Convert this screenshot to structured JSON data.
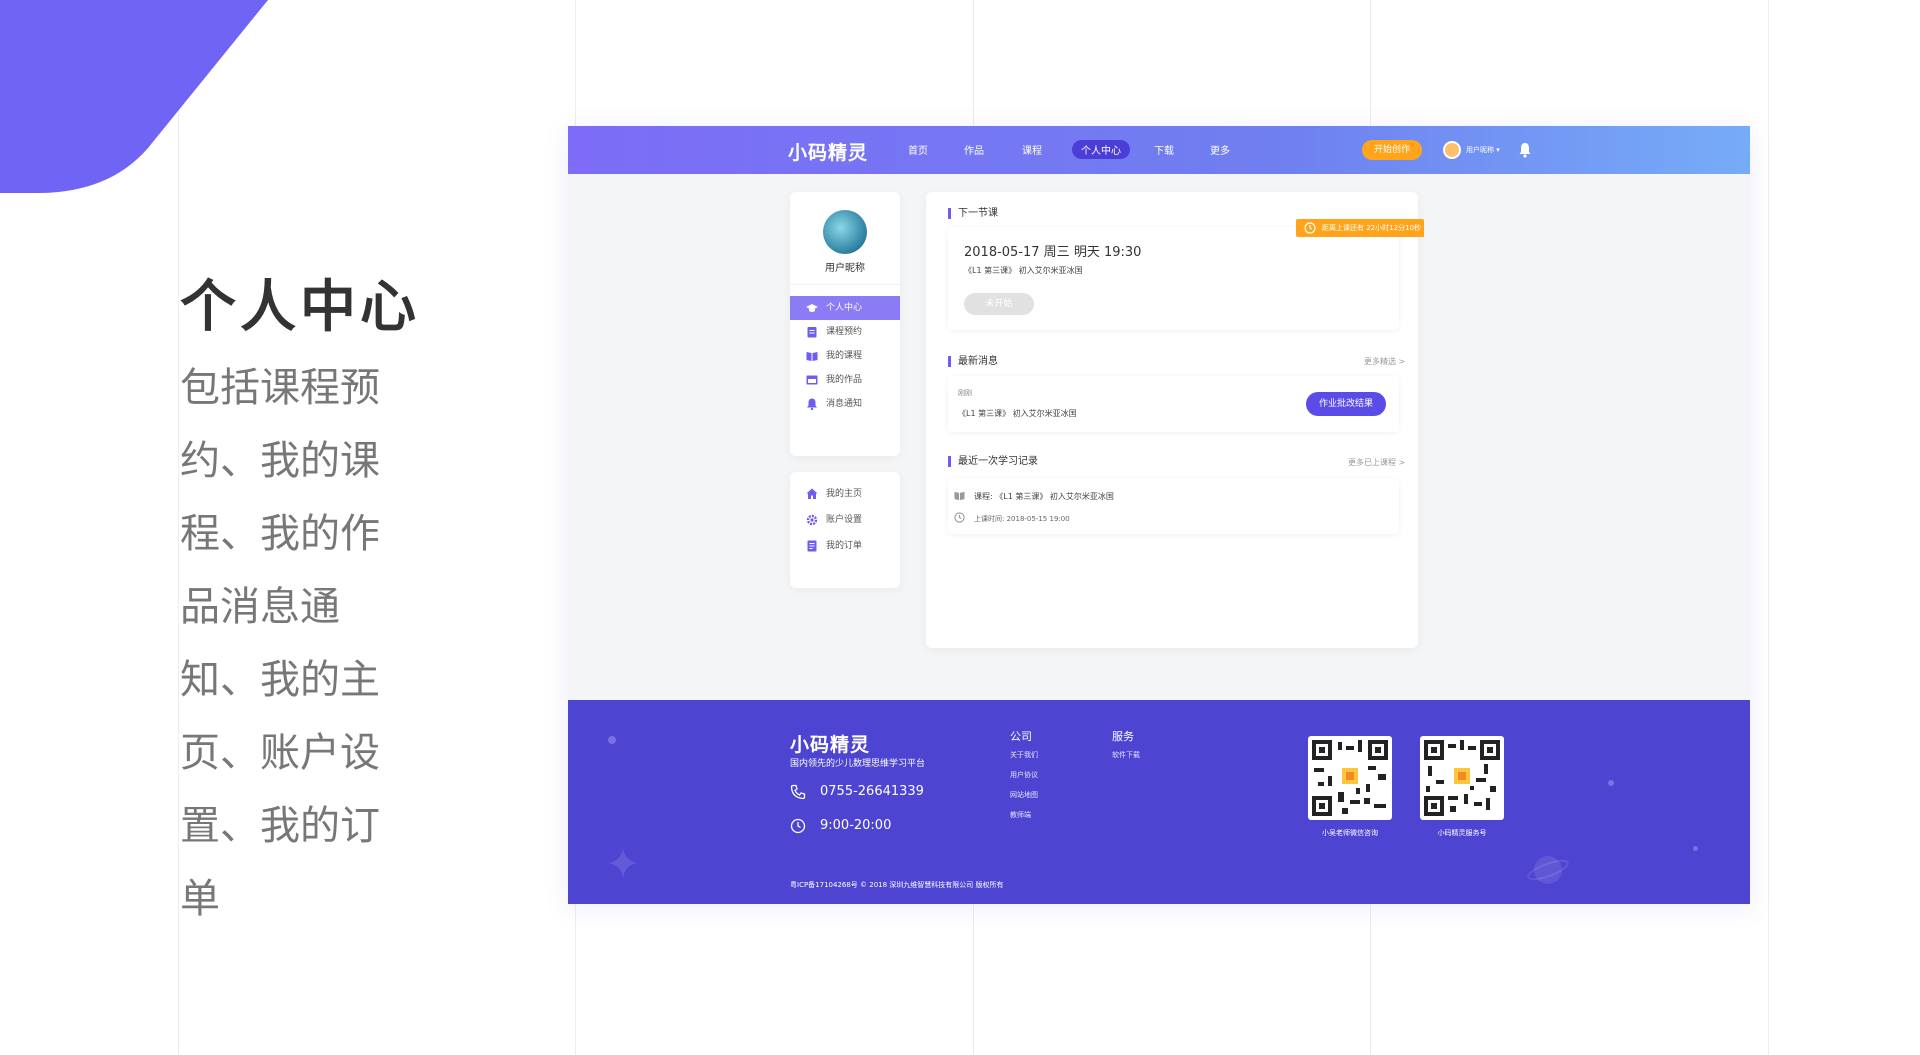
{
  "hero": {
    "title": "个人中心",
    "description": "包括课程预约、我的课程、我的作品消息通知、我的主页、账户设置、我的订单"
  },
  "topbar": {
    "logo": "小码精灵",
    "nav": [
      "首页",
      "作品",
      "课程",
      "个人中心",
      "下载",
      "更多"
    ],
    "active_nav": "个人中心",
    "start_button": "开始创作",
    "username": "用户昵称 ▾"
  },
  "sidebar": {
    "nickname": "用户昵称",
    "menu1": [
      {
        "label": "个人中心",
        "icon": "graduation-cap-icon"
      },
      {
        "label": "课程预约",
        "icon": "clipboard-icon"
      },
      {
        "label": "我的课程",
        "icon": "book-icon"
      },
      {
        "label": "我的作品",
        "icon": "gallery-icon"
      },
      {
        "label": "消息通知",
        "icon": "bell-icon"
      }
    ],
    "menu2": [
      {
        "label": "我的主页",
        "icon": "home-icon"
      },
      {
        "label": "账户设置",
        "icon": "gear-icon"
      },
      {
        "label": "我的订单",
        "icon": "order-icon"
      }
    ]
  },
  "next_lesson": {
    "section_title": "下一节课",
    "countdown": "距离上课还有 22小时12分10秒",
    "time": "2018-05-17  周三  明天  19:30",
    "name": "《L1 第三课》 初入艾尔米亚冰国",
    "status_button": "未开始"
  },
  "latest_message": {
    "section_title": "最新消息",
    "more": "更多精选 >",
    "time": "刚刚",
    "text": "《L1 第三课》 初入艾尔米亚冰国",
    "action_button": "作业批改结果"
  },
  "last_record": {
    "section_title": "最近一次学习记录",
    "more": "更多已上课程 >",
    "course_line": "课程:  《L1 第三课》 初入艾尔米亚冰国",
    "time_line": "上课时间:  2018-05-15 19:00"
  },
  "footer": {
    "logo": "小码精灵",
    "slogan": "国内领先的少儿数理思维学习平台",
    "phone": "0755-26641339",
    "hours": "9:00-20:00",
    "company_title": "公司",
    "company_links": [
      "关于我们",
      "用户协议",
      "网站地图",
      "教师端"
    ],
    "service_title": "服务",
    "service_links": [
      "软件下载"
    ],
    "qr1_label": "小吴老师微信咨询",
    "qr2_label": "小码精灵服务号",
    "copyright": "粤ICP备17104268号 © 2018 深圳九维智慧科技有限公司 版权所有"
  },
  "colors": {
    "accent": "#6f5cf5",
    "footer_bg": "#4d44d2",
    "orange": "#ffa41b"
  }
}
